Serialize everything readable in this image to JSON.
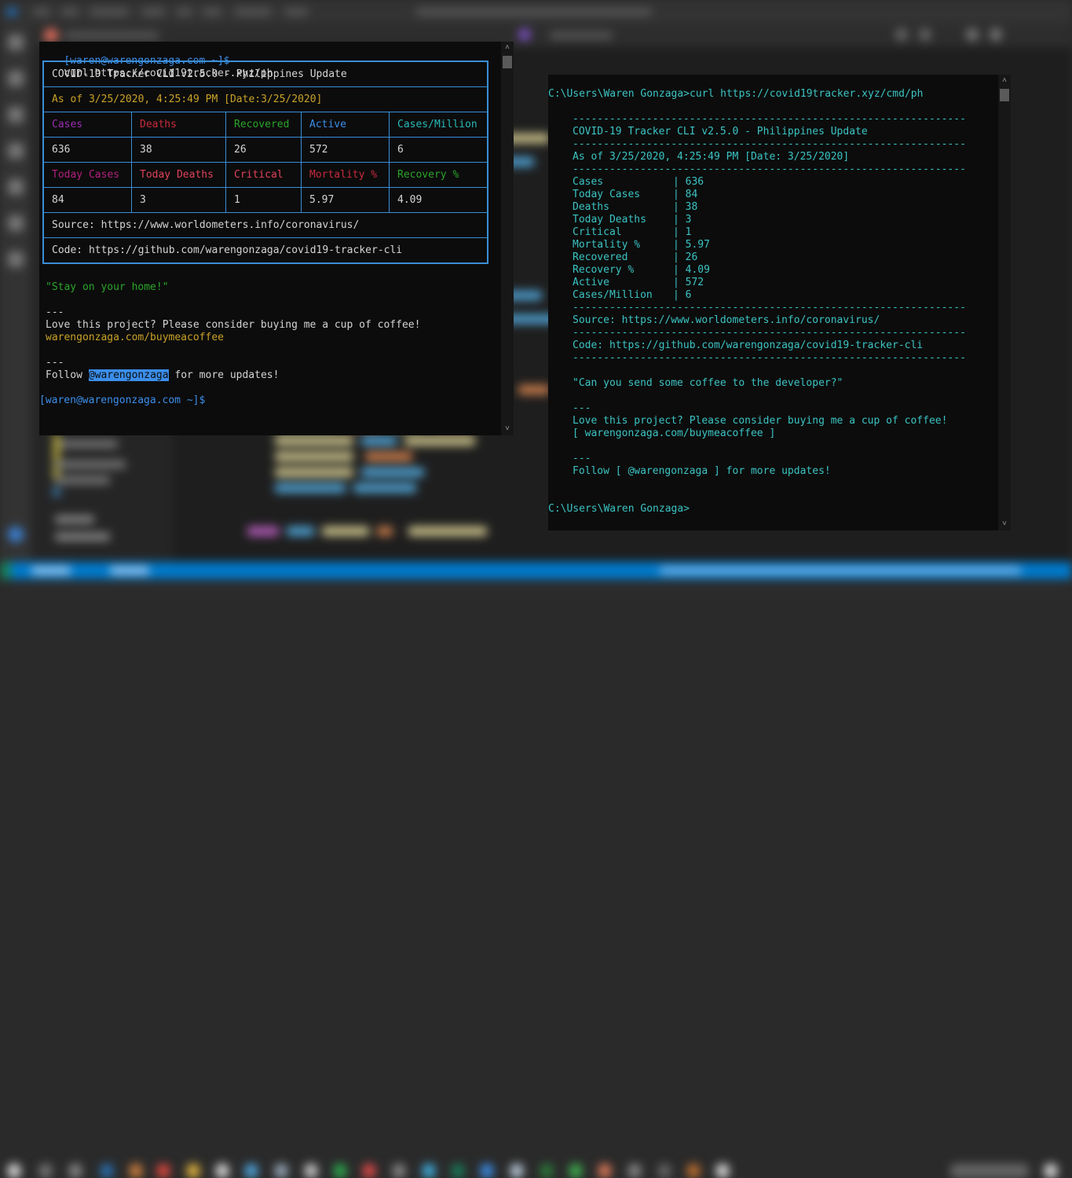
{
  "left_terminal": {
    "prompt": "[waren@warengonzaga.com ~]$",
    "command": "curl https://covid19tracker.xyz/ph",
    "table": {
      "title": "COVID-19 Tracker CLI v2.5.0 - Philippines Update",
      "as_of": "As of 3/25/2020, 4:25:49 PM [Date:3/25/2020]",
      "header_row_1": [
        "Cases",
        "Deaths",
        "Recovered",
        "Active",
        "Cases/Million"
      ],
      "value_row_1": [
        "636",
        "38",
        "26",
        "572",
        "6"
      ],
      "header_row_2": [
        "Today Cases",
        "Today Deaths",
        "Critical",
        "Mortality %",
        "Recovery %"
      ],
      "value_row_2": [
        "84",
        "3",
        "1",
        "5.97",
        "4.09"
      ],
      "source": "Source: https://www.worldometers.info/coronavirus/",
      "code": "Code: https://github.com/warengonzaga/covid19-tracker-cli"
    },
    "quote": "\"Stay on your home!\"",
    "separator": "---",
    "love_text": "Love this project? Please consider buying me a cup of coffee!",
    "coffee_link": "warengonzaga.com/buymeacoffee",
    "follow_prefix": "Follow ",
    "follow_handle": "@warengonzaga",
    "follow_suffix": " for more updates!",
    "end_prompt": "[waren@warengonzaga.com ~]$"
  },
  "right_terminal": {
    "prompt_command": "C:\\Users\\Waren Gonzaga>curl https://covid19tracker.xyz/cmd/ph",
    "divider": "----------------------------------------------------------------",
    "title": "COVID-19 Tracker CLI v2.5.0 - Philippines Update",
    "as_of": "As of 3/25/2020, 4:25:49 PM [Date: 3/25/2020]",
    "stats": [
      {
        "label": "Cases",
        "value": "636"
      },
      {
        "label": "Today Cases",
        "value": "84"
      },
      {
        "label": "Deaths",
        "value": "38"
      },
      {
        "label": "Today Deaths",
        "value": "3"
      },
      {
        "label": "Critical",
        "value": "1"
      },
      {
        "label": "Mortality %",
        "value": "5.97"
      },
      {
        "label": "Recovered",
        "value": "26"
      },
      {
        "label": "Recovery %",
        "value": "4.09"
      },
      {
        "label": "Active",
        "value": "572"
      },
      {
        "label": "Cases/Million",
        "value": "6"
      }
    ],
    "source": "Source: https://www.worldometers.info/coronavirus/",
    "code": "Code: https://github.com/warengonzaga/covid19-tracker-cli",
    "quote": "\"Can you send some coffee to the developer?\"",
    "separator": "---",
    "love_text": "Love this project? Please consider buying me a cup of coffee!",
    "coffee_link": "[ warengonzaga.com/buymeacoffee ]",
    "follow_text": "Follow [ @warengonzaga ] for more updates!",
    "end_prompt": "C:\\Users\\Waren Gonzaga>"
  },
  "scroll": {
    "up_icon": "˄",
    "down_icon": "˅"
  },
  "colors": {
    "table_border": "#3a8ed6",
    "prompt_blue": "#3b8eea",
    "date_yellow": "#c9a227",
    "cmd_cyan": "#3cc3c3",
    "status_bar": "#007acc"
  }
}
